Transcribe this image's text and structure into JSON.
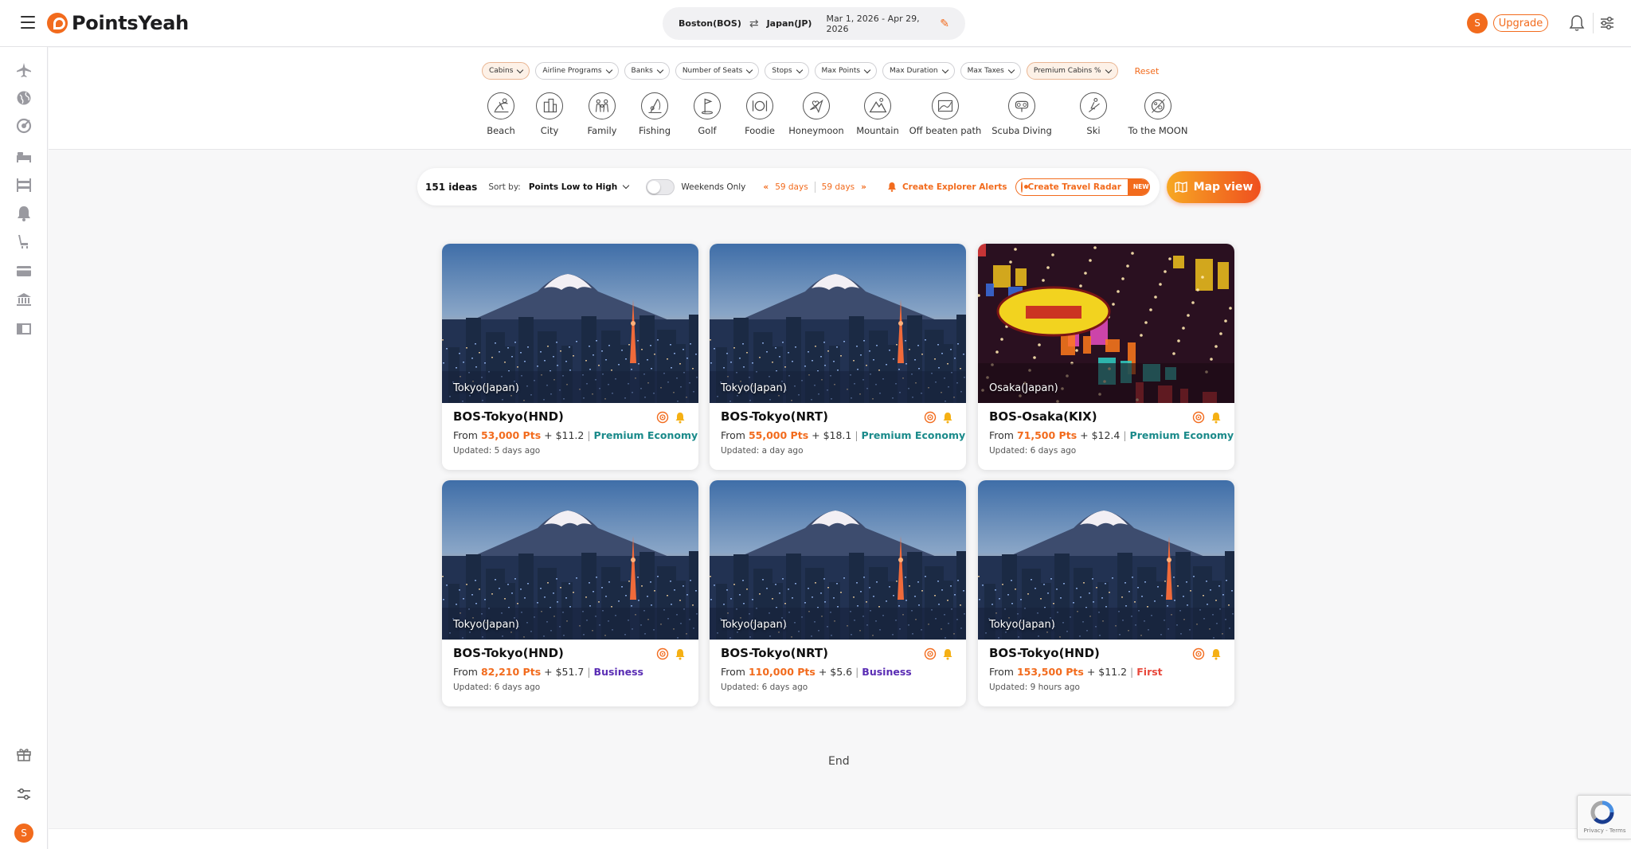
{
  "app": {
    "brand": "PointsYeah",
    "colors": {
      "accent": "#f26b1d",
      "premium_economy": "#1a8a8a",
      "business": "#5a2db4",
      "first": "#e8483b"
    }
  },
  "header": {
    "origin": "Boston(BOS)",
    "destination": "Japan(JP)",
    "dates": "Mar 1, 2026 - Apr 29, 2026",
    "avatar_initial": "S",
    "upgrade_label": "Upgrade"
  },
  "sidebar": {
    "icons": [
      "plane-icon",
      "globe-icon",
      "target-icon",
      "bed-icon",
      "bunk-bed-icon",
      "bell-icon",
      "seat-icon",
      "card-icon",
      "bank-icon",
      "book-icon",
      "gift-icon",
      "sliders-icon"
    ],
    "avatar_initial": "S"
  },
  "filters": {
    "chips": [
      {
        "label": "Cabins",
        "active": true
      },
      {
        "label": "Airline Programs",
        "active": false
      },
      {
        "label": "Banks",
        "active": false
      },
      {
        "label": "Number of Seats",
        "active": false
      },
      {
        "label": "Stops",
        "active": false
      },
      {
        "label": "Max Points",
        "active": false
      },
      {
        "label": "Max Duration",
        "active": false
      },
      {
        "label": "Max Taxes",
        "active": false
      },
      {
        "label": "Premium Cabins %",
        "active": true
      }
    ],
    "reset_label": "Reset"
  },
  "themes": [
    {
      "label": "Beach",
      "icon": "beach-icon"
    },
    {
      "label": "City",
      "icon": "city-icon"
    },
    {
      "label": "Family",
      "icon": "family-icon"
    },
    {
      "label": "Fishing",
      "icon": "fishing-icon"
    },
    {
      "label": "Golf",
      "icon": "golf-icon"
    },
    {
      "label": "Foodie",
      "icon": "foodie-icon"
    },
    {
      "label": "Honeymoon",
      "icon": "honeymoon-icon"
    },
    {
      "label": "Mountain",
      "icon": "mountain-icon"
    },
    {
      "label": "Off beaten path",
      "icon": "off-beaten-path-icon"
    },
    {
      "label": "Scuba Diving",
      "icon": "scuba-diving-icon"
    },
    {
      "label": "Ski",
      "icon": "ski-icon"
    },
    {
      "label": "To the MOON",
      "icon": "moon-icon"
    }
  ],
  "toolbar": {
    "ideas_count": "151 ideas",
    "sort_label": "Sort by:",
    "sort_value": "Points Low to High",
    "weekends_label": "Weekends Only",
    "weekends_on": false,
    "prev_days": "59 days",
    "next_days": "59 days",
    "alerts_label": "Create Explorer Alerts",
    "radar_label": "Create Travel Radar",
    "new_badge": "NEW",
    "map_label": "Map view"
  },
  "cards": [
    {
      "city": "Tokyo(Japan)",
      "title": "BOS-Tokyo(HND)",
      "from": "From",
      "points": "53,000 Pts",
      "tax": "+ $11.2",
      "cabin": "Premium Economy",
      "cabin_class": "pe",
      "updated": "Updated: 5 days ago",
      "image": "fuji"
    },
    {
      "city": "Tokyo(Japan)",
      "title": "BOS-Tokyo(NRT)",
      "from": "From",
      "points": "55,000 Pts",
      "tax": "+ $18.1",
      "cabin": "Premium Economy",
      "cabin_class": "pe",
      "updated": "Updated: a day ago",
      "image": "fuji"
    },
    {
      "city": "Osaka(Japan)",
      "title": "BOS-Osaka(KIX)",
      "from": "From",
      "points": "71,500 Pts",
      "tax": "+ $12.4",
      "cabin": "Premium Economy",
      "cabin_class": "pe",
      "updated": "Updated: 6 days ago",
      "image": "osaka"
    },
    {
      "city": "Tokyo(Japan)",
      "title": "BOS-Tokyo(HND)",
      "from": "From",
      "points": "82,210 Pts",
      "tax": "+ $51.7",
      "cabin": "Business",
      "cabin_class": "biz",
      "updated": "Updated: 6 days ago",
      "image": "fuji"
    },
    {
      "city": "Tokyo(Japan)",
      "title": "BOS-Tokyo(NRT)",
      "from": "From",
      "points": "110,000 Pts",
      "tax": "+ $5.6",
      "cabin": "Business",
      "cabin_class": "biz",
      "updated": "Updated: 6 days ago",
      "image": "fuji"
    },
    {
      "city": "Tokyo(Japan)",
      "title": "BOS-Tokyo(HND)",
      "from": "From",
      "points": "153,500 Pts",
      "tax": "+ $11.2",
      "cabin": "First",
      "cabin_class": "first",
      "updated": "Updated: 9 hours ago",
      "image": "fuji"
    }
  ],
  "end_label": "End",
  "recaptcha_label": "Privacy - Terms"
}
